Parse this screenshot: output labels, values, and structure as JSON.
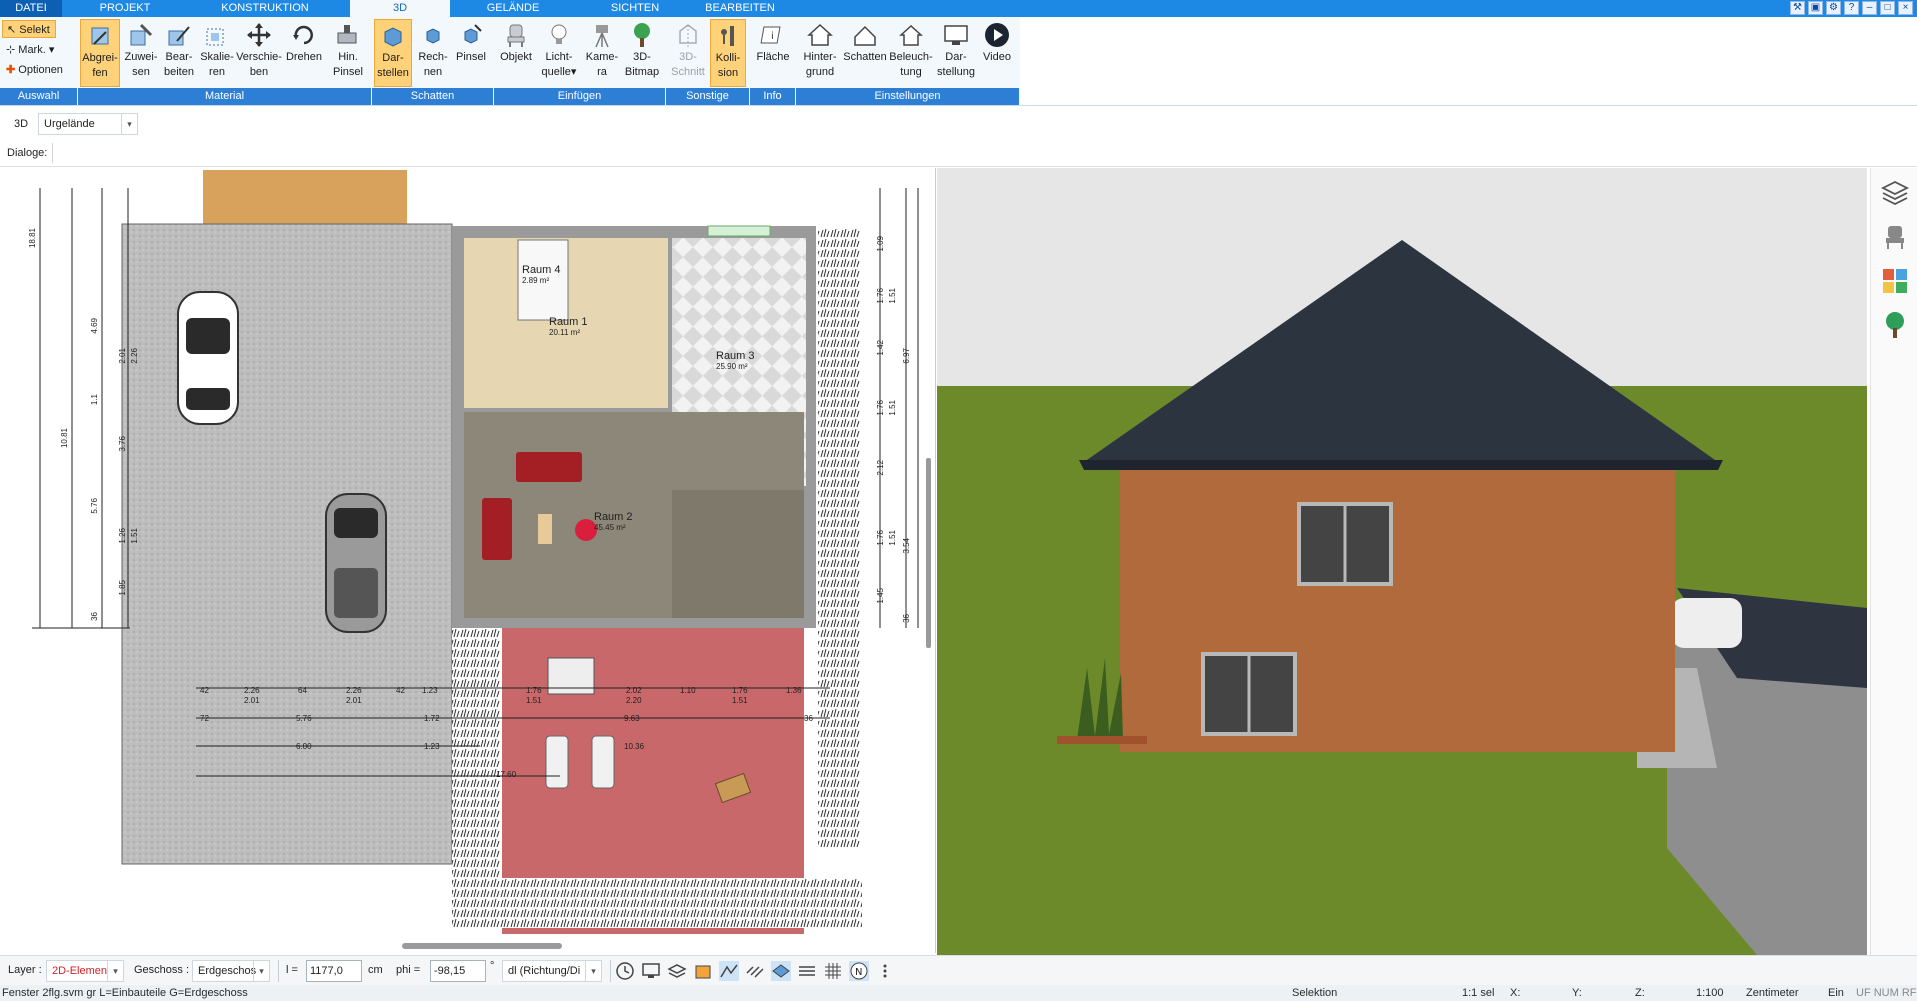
{
  "tabs": [
    "DATEI",
    "PROJEKT",
    "KONSTRUKTION",
    "3D",
    "GELÄNDE",
    "SICHTEN",
    "BEARBEITEN"
  ],
  "window_controls": [
    "–",
    "□",
    "×"
  ],
  "ribbon": {
    "auswahl": {
      "selekt": "Selekt",
      "mark": "Mark.",
      "optionen": "Optionen"
    },
    "buttons": [
      {
        "l1": "Abgrei-",
        "l2": "fen"
      },
      {
        "l1": "Zuwei-",
        "l2": "sen"
      },
      {
        "l1": "Bear-",
        "l2": "beiten"
      },
      {
        "l1": "Skalie-",
        "l2": "ren"
      },
      {
        "l1": "Verschie-",
        "l2": "ben"
      },
      {
        "l1": "Drehen",
        "l2": ""
      },
      {
        "l1": "Hin.",
        "l2": "Pinsel"
      },
      {
        "l1": "Dar-",
        "l2": "stellen"
      },
      {
        "l1": "Rech-",
        "l2": "nen"
      },
      {
        "l1": "Pinsel",
        "l2": ""
      },
      {
        "l1": "Objekt",
        "l2": ""
      },
      {
        "l1": "Licht-",
        "l2": "quelle"
      },
      {
        "l1": "Kame-",
        "l2": "ra"
      },
      {
        "l1": "3D-",
        "l2": "Bitmap"
      },
      {
        "l1": "3D-",
        "l2": "Schnitt"
      },
      {
        "l1": "Kolli-",
        "l2": "sion"
      },
      {
        "l1": "Fläche",
        "l2": ""
      },
      {
        "l1": "Hinter-",
        "l2": "grund"
      },
      {
        "l1": "Schatten",
        "l2": ""
      },
      {
        "l1": "Beleuch-",
        "l2": "tung"
      },
      {
        "l1": "Dar-",
        "l2": "stellung"
      },
      {
        "l1": "Video",
        "l2": ""
      }
    ],
    "groups": [
      "Auswahl",
      "Material",
      "Schatten",
      "Einfügen",
      "Sonstige",
      "Info",
      "Einstellungen"
    ]
  },
  "row2": {
    "mode": "3D",
    "terrain": "Urgelände"
  },
  "row3": {
    "dialoge": "Dialoge:"
  },
  "plan": {
    "rooms": [
      {
        "name": "Raum 4",
        "area": "2.89 m²"
      },
      {
        "name": "Raum 1",
        "area": "20.11 m²"
      },
      {
        "name": "Raum 3",
        "area": "25.90 m²"
      },
      {
        "name": "Raum 2",
        "area": "45.45 m²"
      }
    ],
    "dims_left": [
      "18.81",
      "10.81",
      "4.69",
      "2.01",
      "2.26",
      "1.1",
      "3.76",
      "5.76",
      "1.26",
      "1.51",
      "1.85",
      "36"
    ],
    "dims_right": [
      "1.09",
      "1.76",
      "1.51",
      "1.42",
      "6.97",
      "1.51",
      "1.76",
      "2.12",
      "3.54",
      "1.51",
      "1.76",
      "1.45",
      "36"
    ],
    "dims_bottom_row1": [
      "42",
      "2.26",
      "64",
      "2.26",
      "42",
      "1.23",
      "1.76",
      "2.02",
      "1.10",
      "1.76",
      "1.36"
    ],
    "dims_bottom_row1b": [
      "2.01",
      "2.01",
      "1.51",
      "2.20",
      "1.51"
    ],
    "dims_bottom_row2": [
      "72",
      "5.76",
      "1.72",
      "9.63",
      "36"
    ],
    "dims_bottom_row3": [
      "6.00",
      "1.23",
      "10.36"
    ],
    "dims_bottom_row4": [
      "17.60"
    ]
  },
  "bottombar": {
    "layer_label": "Layer :",
    "layer_value": "2D-Elemen",
    "geschoss_label": "Geschoss :",
    "geschoss_value": "Erdgeschos",
    "l_label": "l =",
    "l_value": "1177,0",
    "l_unit": "cm",
    "phi_label": "phi =",
    "phi_value": "-98,15",
    "phi_unit": "°",
    "dl_value": "dl (Richtung/Di"
  },
  "status": {
    "left": "Fenster 2flg.svm gr L=Einbauteile G=Erdgeschoss",
    "selektion": "Selektion",
    "sel_ratio": "1:1 sel",
    "x": "X:",
    "y": "Y:",
    "z": "Z:",
    "scale": "1:100",
    "unit": "Zentimeter",
    "ein": "Ein",
    "flags": "UF NUM RF"
  },
  "colors": {
    "tabbar": "#1e88e5",
    "group_bar": "#2d7fd6",
    "highlight": "#ffd27a",
    "house_wall": "#b06a3b",
    "roof": "#2c3440",
    "grass": "#6c8a2a",
    "sky": "#e6e6e6",
    "terrace": "#c8686a"
  }
}
